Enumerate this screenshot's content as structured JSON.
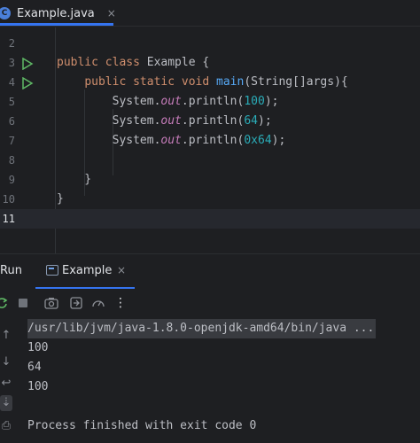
{
  "editor_tab": {
    "icon": "C",
    "label": "Example.java",
    "close": "×"
  },
  "editor": {
    "lines": [
      {
        "num": "2",
        "html": ""
      },
      {
        "num": "3",
        "html": "<span class=\"kw\">public class</span> Example {"
      },
      {
        "num": "4",
        "html": "    <span class=\"kw\">public static void</span> <span class=\"fn\">main</span>(String[]args){"
      },
      {
        "num": "5",
        "html": "        System.<span class=\"static\">out</span>.println(<span class=\"num\">100</span>);"
      },
      {
        "num": "6",
        "html": "        System.<span class=\"static\">out</span>.println(<span class=\"num\">64</span>);"
      },
      {
        "num": "7",
        "html": "        System.<span class=\"static\">out</span>.println(<span class=\"num\">0x64</span>);"
      },
      {
        "num": "8",
        "html": ""
      },
      {
        "num": "9",
        "html": "    }"
      },
      {
        "num": "10",
        "html": "}"
      },
      {
        "num": "11",
        "html": ""
      }
    ]
  },
  "run_panel": {
    "title": "Run",
    "tab_label": "Example",
    "tab_close": "×",
    "more": "⋮"
  },
  "console": {
    "command": "/usr/lib/jvm/java-1.8.0-openjdk-amd64/bin/java ...",
    "output": [
      "100",
      "64",
      "100",
      "",
      "Process finished with exit code 0"
    ]
  }
}
